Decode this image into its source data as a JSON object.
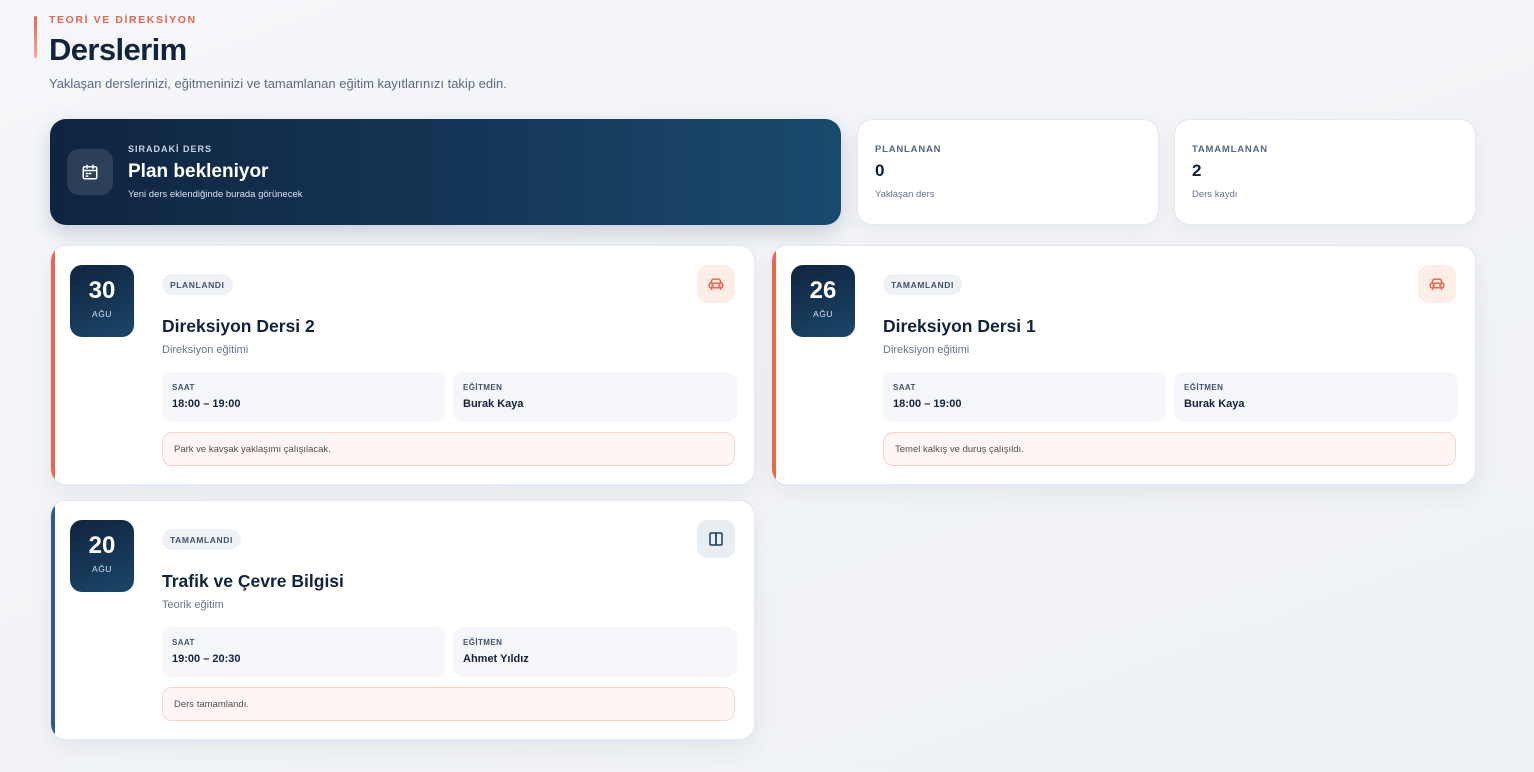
{
  "header": {
    "eyebrow": "TEORİ VE DİREKSİYON",
    "title": "Derslerim",
    "subtitle": "Yaklaşan derslerinizi, eğitmeninizi ve tamamlanan eğitim kayıtlarınızı takip edin."
  },
  "next_lesson": {
    "eyebrow": "SIRADAKİ DERS",
    "title": "Plan bekleniyor",
    "description": "Yeni ders eklendiğinde burada görünecek",
    "icon": "calendar-icon"
  },
  "stats": [
    {
      "label": "PLANLANAN",
      "value": "0",
      "sub": "Yaklaşan ders"
    },
    {
      "label": "TAMAMLANAN",
      "value": "2",
      "sub": "Ders kaydı"
    }
  ],
  "lessons": [
    {
      "day": "30",
      "month": "AĞU",
      "status": "PLANLANDI",
      "title": "Direksiyon Dersi 2",
      "type": "Direksiyon eğitimi",
      "time_label": "SAAT",
      "time": "18:00 – 19:00",
      "instructor_label": "EĞİTMEN",
      "instructor": "Burak Kaya",
      "note": "Park ve kavşak yaklaşımı çalışılacak.",
      "icon": "car-icon",
      "accent": "#e8684d"
    },
    {
      "day": "26",
      "month": "AĞU",
      "status": "TAMAMLANDI",
      "title": "Direksiyon Dersi 1",
      "type": "Direksiyon eğitimi",
      "time_label": "SAAT",
      "time": "18:00 – 19:00",
      "instructor_label": "EĞİTMEN",
      "instructor": "Burak Kaya",
      "note": "Temel kalkış ve duruş çalışıldı.",
      "icon": "car-icon",
      "accent": "#e8684d"
    },
    {
      "day": "20",
      "month": "AĞU",
      "status": "TAMAMLANDI",
      "title": "Trafik ve Çevre Bilgisi",
      "type": "Teorik eğitim",
      "time_label": "SAAT",
      "time": "19:00 – 20:30",
      "instructor_label": "EĞİTMEN",
      "instructor": "Ahmet Yıldız",
      "note": "Ders tamamlandı.",
      "icon": "book-icon",
      "accent": "#2b5d85"
    }
  ]
}
